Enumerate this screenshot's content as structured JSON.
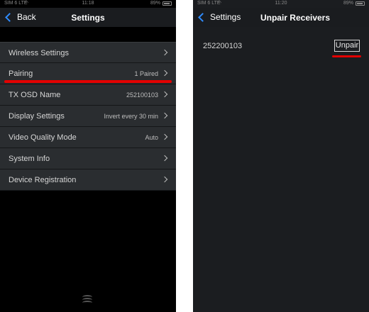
{
  "left": {
    "statusbar": {
      "carrier": "SIM 6 LTE",
      "time": "11:18",
      "battery": "89%"
    },
    "nav": {
      "back_label": "Back",
      "title": "Settings"
    },
    "rows": [
      {
        "label": "Wireless Settings",
        "value": ""
      },
      {
        "label": "Pairing",
        "value": "1 Paired"
      },
      {
        "label": "TX OSD Name",
        "value": "252100103"
      },
      {
        "label": "Display Settings",
        "value": "Invert every 30 min"
      },
      {
        "label": "Video Quality Mode",
        "value": "Auto"
      },
      {
        "label": "System Info",
        "value": ""
      },
      {
        "label": "Device Registration",
        "value": ""
      }
    ]
  },
  "right": {
    "statusbar": {
      "carrier": "SIM 6 LTE",
      "time": "11:20",
      "battery": "89%"
    },
    "nav": {
      "back_label": "Settings",
      "title": "Unpair Receivers"
    },
    "receiver_id": "252200103",
    "unpair_label": "Unpair"
  },
  "colors": {
    "accent": "#2f8cff",
    "highlight": "#e30000",
    "row_bg": "#2a2d30"
  },
  "icons": [
    "back-chevron-icon",
    "chevron-right-icon",
    "wifi-icon",
    "battery-icon",
    "home-indicator-icon"
  ]
}
